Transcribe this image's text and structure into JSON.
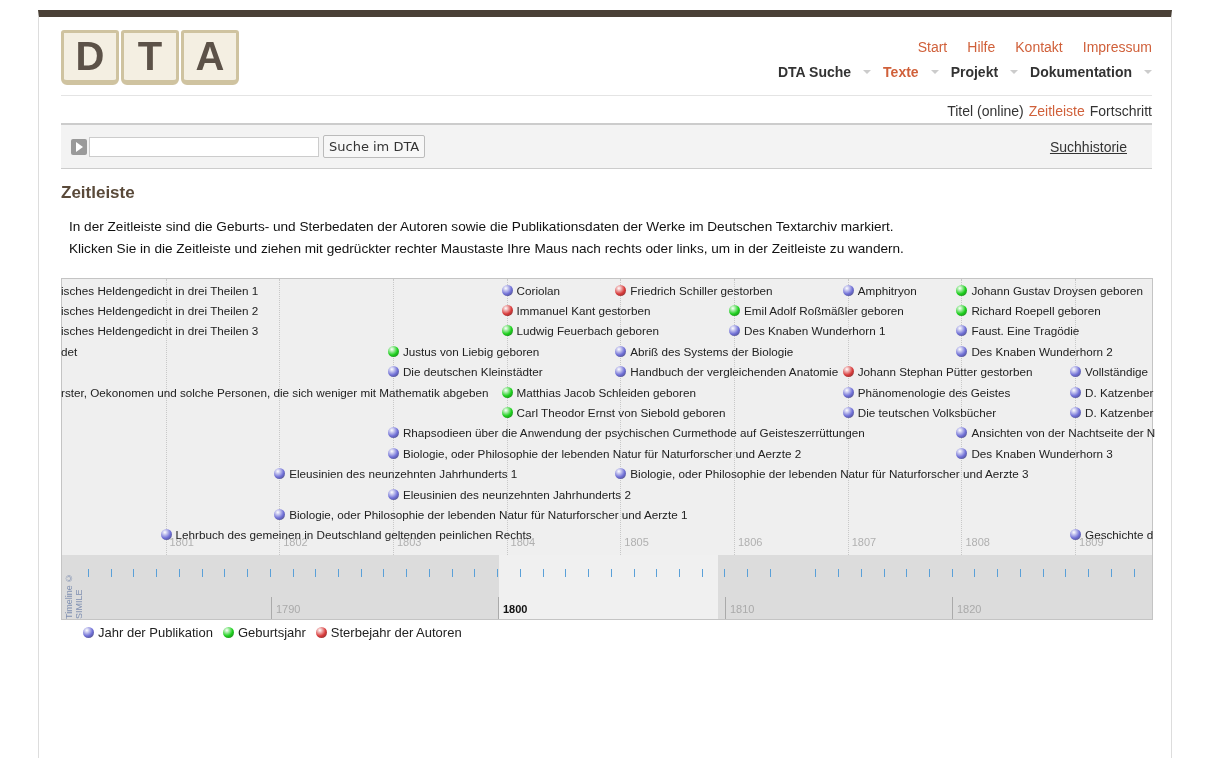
{
  "logo": [
    "D",
    "T",
    "A"
  ],
  "top_links": [
    "Start",
    "Hilfe",
    "Kontakt",
    "Impressum"
  ],
  "main_nav": [
    {
      "label": "DTA Suche",
      "selected": false
    },
    {
      "label": "Texte",
      "selected": true
    },
    {
      "label": "Projekt",
      "selected": false
    },
    {
      "label": "Dokumentation",
      "selected": false
    }
  ],
  "sub_nav": [
    {
      "label": "Titel (online)",
      "selected": false
    },
    {
      "label": "Zeitleiste",
      "selected": true
    },
    {
      "label": "Fortschritt",
      "selected": false
    }
  ],
  "search": {
    "button": "Suche im DTA",
    "history": "Suchhistorie"
  },
  "heading": "Zeitleiste",
  "paragraphs": [
    "In der Zeitleiste sind die Geburts- und Sterbedaten der Autoren sowie die Publikationsdaten der Werke im Deutschen Textarchiv markiert.",
    "Klicken Sie in die Zeitleiste und ziehen mit gedrückter rechter Maustaste Ihre Maus nach rechts oder links, um in der Zeitleiste zu wandern."
  ],
  "timeline": {
    "years": [
      "1801",
      "1802",
      "1803",
      "1804",
      "1805",
      "1806",
      "1807",
      "1808",
      "1809"
    ],
    "rows": [
      {
        "slots": [
          {
            "kind": "cut",
            "text": "isches Heldengedicht in drei Theilen 1"
          },
          {
            "kind": "gap"
          },
          {
            "kind": "gap"
          },
          {
            "kind": "gap"
          },
          {
            "kind": "publication",
            "text": "Coriolan"
          },
          {
            "kind": "death",
            "text": "Friedrich Schiller gestorben"
          },
          {
            "kind": "gap"
          },
          {
            "kind": "publication",
            "text": "Amphitryon"
          },
          {
            "kind": "birth",
            "text": "Johann Gustav Droysen geboren"
          }
        ]
      },
      {
        "slots": [
          {
            "kind": "cut",
            "text": "isches Heldengedicht in drei Theilen 2"
          },
          {
            "kind": "gap"
          },
          {
            "kind": "gap"
          },
          {
            "kind": "gap"
          },
          {
            "kind": "death",
            "text": "Immanuel Kant gestorben"
          },
          {
            "kind": "gap"
          },
          {
            "kind": "birth",
            "text": "Emil Adolf Roßmäßler geboren"
          },
          {
            "kind": "gap"
          },
          {
            "kind": "birth",
            "text": "Richard Roepell geboren"
          }
        ]
      },
      {
        "slots": [
          {
            "kind": "cut",
            "text": "isches Heldengedicht in drei Theilen 3"
          },
          {
            "kind": "gap"
          },
          {
            "kind": "gap"
          },
          {
            "kind": "gap"
          },
          {
            "kind": "birth",
            "text": "Ludwig Feuerbach geboren"
          },
          {
            "kind": "gap"
          },
          {
            "kind": "publication",
            "text": "Des Knaben Wunderhorn 1"
          },
          {
            "kind": "gap"
          },
          {
            "kind": "publication",
            "text": "Faust. Eine Tragödie"
          }
        ]
      },
      {
        "slots": [
          {
            "kind": "cut",
            "text": "det"
          },
          {
            "kind": "gap"
          },
          {
            "kind": "gap"
          },
          {
            "kind": "birth",
            "text": "Justus von Liebig geboren"
          },
          {
            "kind": "gap"
          },
          {
            "kind": "publication",
            "text": "Abriß des Systems der Biologie"
          },
          {
            "kind": "gap"
          },
          {
            "kind": "gap"
          },
          {
            "kind": "publication",
            "text": "Des Knaben Wunderhorn 2"
          }
        ]
      },
      {
        "slots": [
          {
            "kind": "gap"
          },
          {
            "kind": "gap"
          },
          {
            "kind": "gap"
          },
          {
            "kind": "publication",
            "text": "Die deutschen Kleinstädter"
          },
          {
            "kind": "gap"
          },
          {
            "kind": "publication",
            "text": "Handbuch der vergleichenden Anatomie"
          },
          {
            "kind": "gap"
          },
          {
            "kind": "death",
            "text": "Johann Stephan Pütter gestorben"
          },
          {
            "kind": "gap"
          },
          {
            "kind": "publication",
            "text": "Vollständige"
          }
        ]
      },
      {
        "slots": [
          {
            "kind": "cut",
            "text": "rster, Oekonomen und solche Personen, die sich weniger mit Mathematik abgeben"
          },
          {
            "kind": "gap"
          },
          {
            "kind": "gap"
          },
          {
            "kind": "gap"
          },
          {
            "kind": "birth",
            "text": "Matthias Jacob Schleiden geboren"
          },
          {
            "kind": "gap"
          },
          {
            "kind": "gap"
          },
          {
            "kind": "publication",
            "text": "Phänomenologie des Geistes"
          },
          {
            "kind": "gap"
          },
          {
            "kind": "publication",
            "text": "D. Katzenber"
          }
        ]
      },
      {
        "slots": [
          {
            "kind": "gap"
          },
          {
            "kind": "gap"
          },
          {
            "kind": "gap"
          },
          {
            "kind": "gap"
          },
          {
            "kind": "birth",
            "text": "Carl Theodor Ernst von Siebold geboren"
          },
          {
            "kind": "gap"
          },
          {
            "kind": "gap"
          },
          {
            "kind": "publication",
            "text": "Die teutschen Volksbücher"
          },
          {
            "kind": "gap"
          },
          {
            "kind": "publication",
            "text": "D. Katzenber"
          }
        ]
      },
      {
        "slots": [
          {
            "kind": "gap"
          },
          {
            "kind": "gap"
          },
          {
            "kind": "gap"
          },
          {
            "kind": "publication",
            "text": "Rhapsodieen über die Anwendung der psychischen Curmethode auf Geisteszerrüttungen"
          },
          {
            "kind": "gap"
          },
          {
            "kind": "gap"
          },
          {
            "kind": "gap"
          },
          {
            "kind": "gap"
          },
          {
            "kind": "publication",
            "text": "Ansichten von der Nachtseite der N"
          }
        ]
      },
      {
        "slots": [
          {
            "kind": "gap"
          },
          {
            "kind": "gap"
          },
          {
            "kind": "gap"
          },
          {
            "kind": "publication",
            "text": "Biologie, oder Philosophie der lebenden Natur für Naturforscher und Aerzte 2"
          },
          {
            "kind": "gap"
          },
          {
            "kind": "gap"
          },
          {
            "kind": "gap"
          },
          {
            "kind": "gap"
          },
          {
            "kind": "publication",
            "text": "Des Knaben Wunderhorn 3"
          }
        ]
      },
      {
        "slots": [
          {
            "kind": "gap"
          },
          {
            "kind": "gap"
          },
          {
            "kind": "publication",
            "text": "Eleusinien des neunzehnten Jahrhunderts 1"
          },
          {
            "kind": "gap"
          },
          {
            "kind": "gap"
          },
          {
            "kind": "publication",
            "text": "Biologie, oder Philosophie der lebenden Natur für Naturforscher und Aerzte 3"
          }
        ]
      },
      {
        "slots": [
          {
            "kind": "gap"
          },
          {
            "kind": "gap"
          },
          {
            "kind": "gap"
          },
          {
            "kind": "publication",
            "text": "Eleusinien des neunzehnten Jahrhunderts 2"
          }
        ]
      },
      {
        "slots": [
          {
            "kind": "gap"
          },
          {
            "kind": "gap"
          },
          {
            "kind": "publication",
            "text": "Biologie, oder Philosophie der lebenden Natur für Naturforscher und Aerzte 1"
          }
        ]
      },
      {
        "slots": [
          {
            "kind": "gap"
          },
          {
            "kind": "publication",
            "text": "Lehrbuch des gemeinen in Deutschland geltenden peinlichen Rechts"
          },
          {
            "kind": "gap"
          },
          {
            "kind": "gap"
          },
          {
            "kind": "gap"
          },
          {
            "kind": "gap"
          },
          {
            "kind": "gap"
          },
          {
            "kind": "gap"
          },
          {
            "kind": "gap"
          },
          {
            "kind": "publication",
            "text": "Geschichte d"
          }
        ]
      }
    ],
    "credit": "Timeline © SIMILE",
    "decades": [
      {
        "label": "1790",
        "selected": false
      },
      {
        "label": "1800",
        "selected": true
      },
      {
        "label": "1810",
        "selected": false
      },
      {
        "label": "1820",
        "selected": false
      }
    ]
  },
  "legend": [
    {
      "kind": "publication",
      "label": "Jahr der Publikation"
    },
    {
      "kind": "birth",
      "label": "Geburtsjahr"
    },
    {
      "kind": "death",
      "label": "Sterbejahr der Autoren"
    }
  ]
}
